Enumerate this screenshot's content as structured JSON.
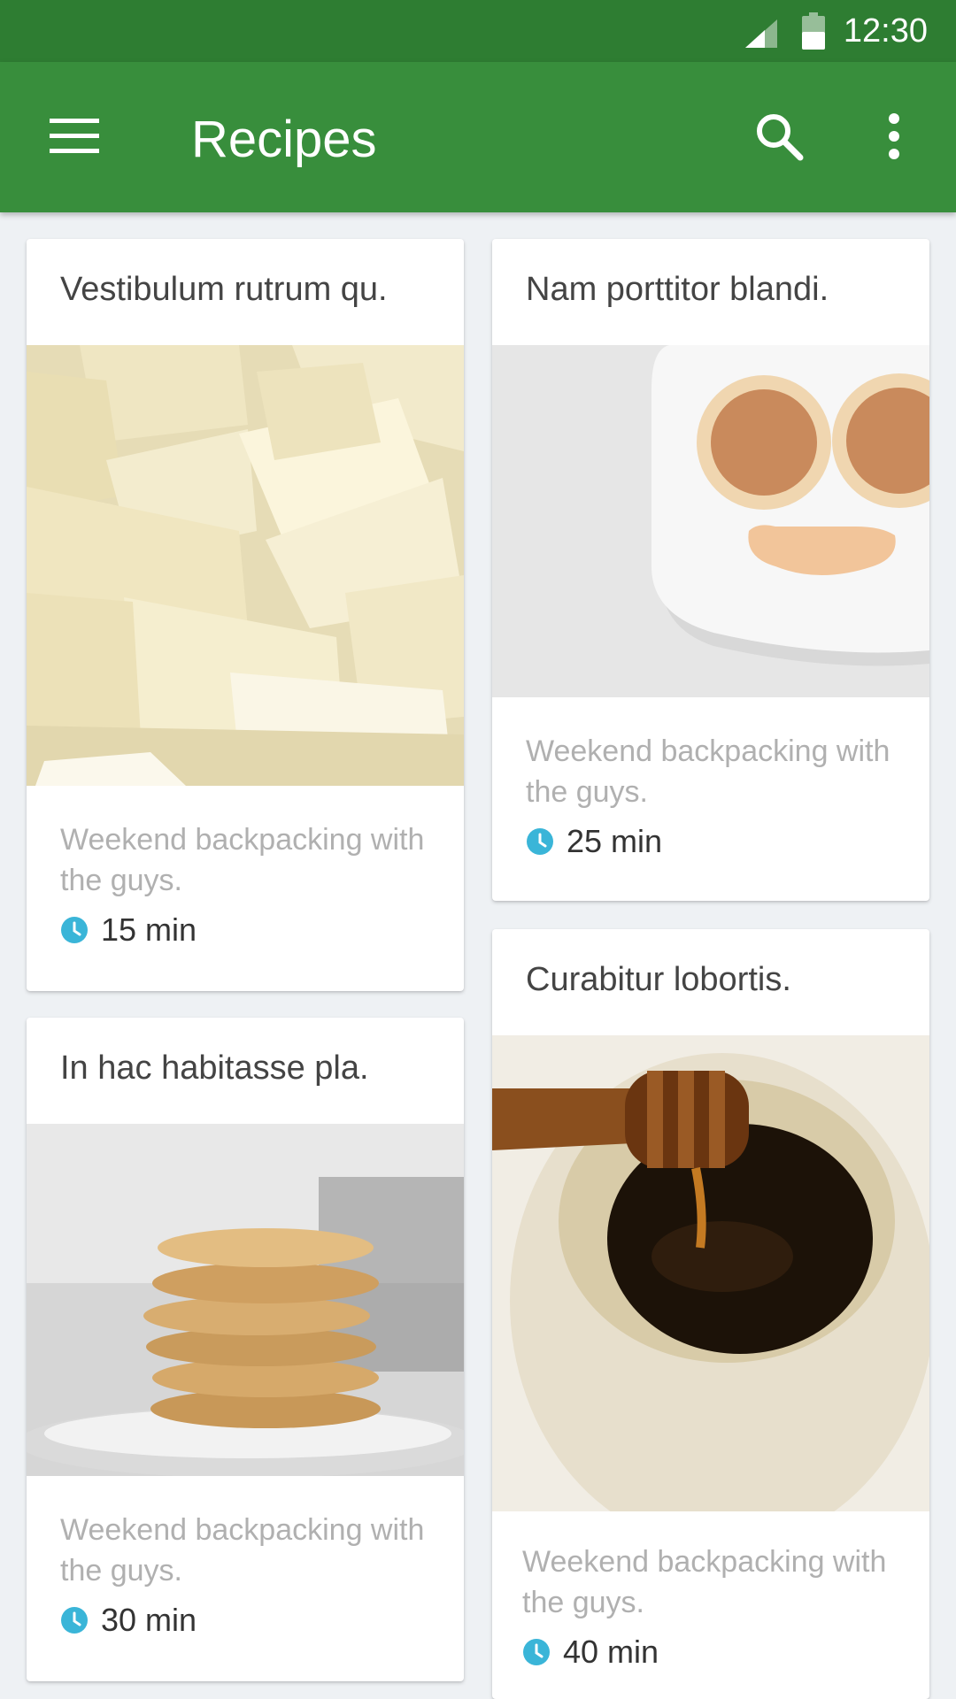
{
  "status_bar": {
    "time": "12:30",
    "icons": [
      "signal-icon",
      "battery-icon"
    ]
  },
  "app_bar": {
    "title": "Recipes",
    "icons": [
      "menu-icon",
      "search-icon",
      "more-vert-icon"
    ]
  },
  "colors": {
    "status_bar": "#2e7d32",
    "app_bar": "#388e3c",
    "accent": "#3ab5d8",
    "background": "#eef1f4"
  },
  "cards": [
    {
      "title": "Vestibulum rutrum qu.",
      "image": "white-chocolate-photo",
      "description": "Weekend backpacking with the guys.",
      "time": "15 min"
    },
    {
      "title": "Nam porttitor blandi.",
      "image": "pancake-smiley-plate-photo",
      "description": "Weekend backpacking with the guys.",
      "time": "25 min"
    },
    {
      "title": "In hac habitasse pla.",
      "image": "cookie-stack-photo",
      "description": "Weekend backpacking with the guys.",
      "time": "30 min"
    },
    {
      "title": "Curabitur lobortis.",
      "image": "honey-dipper-jar-photo",
      "description": "Weekend backpacking with the guys.",
      "time": "40 min"
    }
  ]
}
